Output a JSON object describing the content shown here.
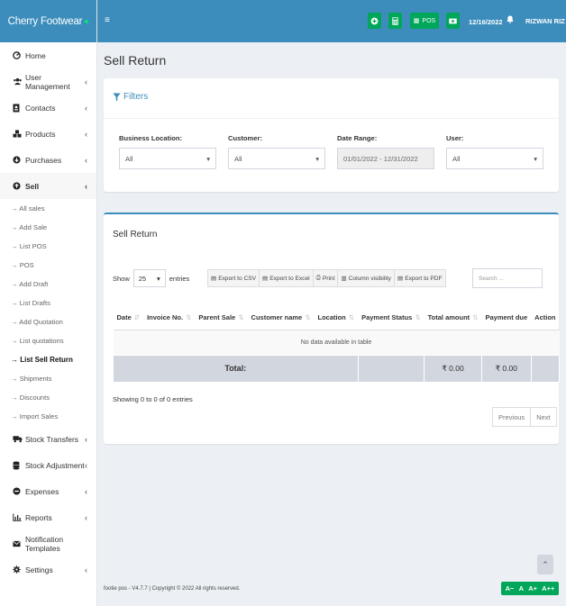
{
  "brand": {
    "name": "Cherry Footwear"
  },
  "header": {
    "pos_label": "POS",
    "date": "12/16/2022",
    "user": "RIZWAN RIZ"
  },
  "sidebar": {
    "items": [
      {
        "label": "Home",
        "icon": "dashboard-icon"
      },
      {
        "label": "User Management",
        "icon": "users-icon"
      },
      {
        "label": "Contacts",
        "icon": "address-book-icon"
      },
      {
        "label": "Products",
        "icon": "cubes-icon"
      },
      {
        "label": "Purchases",
        "icon": "arrow-circle-down-icon"
      },
      {
        "label": "Sell",
        "icon": "arrow-circle-up-icon"
      }
    ],
    "sell_sub": [
      "→ All sales",
      "→ Add Sale",
      "→ List POS",
      "→ POS",
      "→ Add Draft",
      "→ List Drafts",
      "→ Add Quotation",
      "→ List quotations",
      "→ List Sell Return",
      "→ Shipments",
      "→ Discounts",
      "→ Import Sales"
    ],
    "items_after": [
      {
        "label": "Stock Transfers",
        "icon": "truck-icon"
      },
      {
        "label": "Stock Adjustment",
        "icon": "database-icon"
      },
      {
        "label": "Expenses",
        "icon": "minus-circle-icon"
      },
      {
        "label": "Reports",
        "icon": "chart-icon"
      },
      {
        "label": "Notification Templates",
        "icon": "envelope-icon"
      },
      {
        "label": "Settings",
        "icon": "cog-icon"
      }
    ]
  },
  "page": {
    "title": "Sell Return"
  },
  "filters": {
    "title": "Filters",
    "business_location": {
      "label": "Business Location:",
      "value": "All"
    },
    "customer": {
      "label": "Customer:",
      "value": "All"
    },
    "date_range": {
      "label": "Date Range:",
      "value": "01/01/2022 - 12/31/2022"
    },
    "user": {
      "label": "User:",
      "value": "All"
    }
  },
  "table_box": {
    "title": "Sell Return",
    "show_label": "Show",
    "entries_value": "25",
    "entries_label": "entries",
    "buttons": [
      "Export to CSV",
      "Export to Excel",
      "Print",
      "Column visibility",
      "Export to PDF"
    ],
    "search_placeholder": "Search ...",
    "columns": [
      "Date",
      "Invoice No.",
      "Parent Sale",
      "Customer name",
      "Location",
      "Payment Status",
      "Total amount",
      "Payment due",
      "Action"
    ],
    "empty_text": "No data available in table",
    "footer_label": "Total:",
    "total_amount": "₹ 0.00",
    "payment_due": "₹ 0.00",
    "info": "Showing 0 to 0 of 0 entries",
    "prev": "Previous",
    "next": "Next"
  },
  "footer": {
    "text": "footie pos - V4.7.7 | Copyright © 2022 All rights reserved."
  },
  "font_controls": [
    "A−",
    "A",
    "A+",
    "A++"
  ],
  "colors": {
    "primary": "#3c8dbc",
    "success": "#00a65a"
  }
}
